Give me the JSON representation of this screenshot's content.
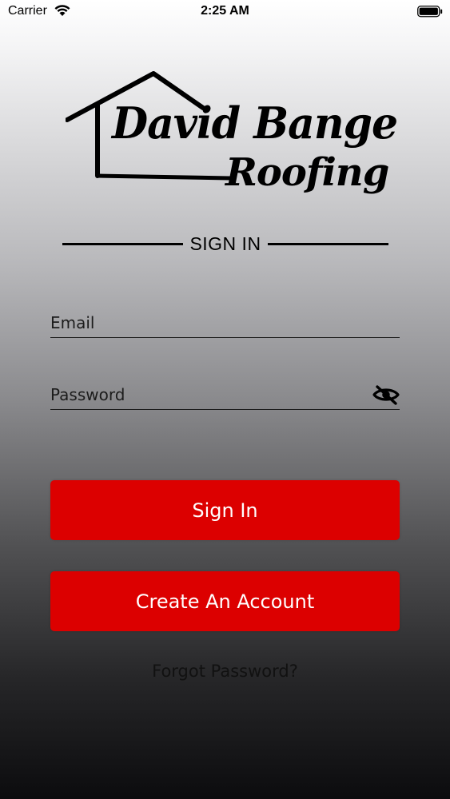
{
  "status_bar": {
    "carrier": "Carrier",
    "time": "2:25 AM"
  },
  "logo": {
    "line1": "David Bange",
    "line2": "Roofing"
  },
  "heading": "SIGN IN",
  "form": {
    "email_placeholder": "Email",
    "password_placeholder": "Password",
    "password_toggle_icon": "eye-slash-icon"
  },
  "buttons": {
    "sign_in": "Sign In",
    "create_account": "Create An Account"
  },
  "forgot_password": "Forgot Password?",
  "colors": {
    "button_red": "#dc0000",
    "text": "#111111"
  }
}
